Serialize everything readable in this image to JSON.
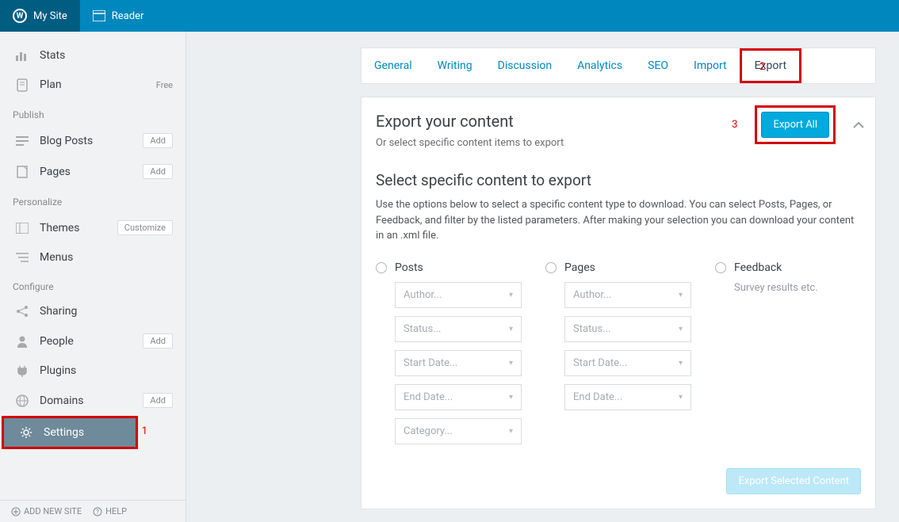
{
  "topbar": {
    "mysite": "My Site",
    "reader": "Reader"
  },
  "sidebar": {
    "stats": "Stats",
    "plan": "Plan",
    "plan_badge": "Free",
    "group_publish": "Publish",
    "blog_posts": "Blog Posts",
    "pages": "Pages",
    "add": "Add",
    "group_personalize": "Personalize",
    "themes": "Themes",
    "customize": "Customize",
    "menus": "Menus",
    "group_configure": "Configure",
    "sharing": "Sharing",
    "people": "People",
    "plugins": "Plugins",
    "domains": "Domains",
    "settings": "Settings",
    "footer_add": "ADD NEW SITE",
    "footer_help": "HELP"
  },
  "tabs": {
    "general": "General",
    "writing": "Writing",
    "discussion": "Discussion",
    "analytics": "Analytics",
    "seo": "SEO",
    "import": "Import",
    "export": "Export"
  },
  "export": {
    "title": "Export your content",
    "subtitle": "Or select specific content items to export",
    "button": "Export All",
    "section_title": "Select specific content to export",
    "section_desc": "Use the options below to select a specific content type to download. You can select Posts, Pages, or Feedback, and filter by the listed parameters. After making your selection you can download your content in an .xml file.",
    "posts": "Posts",
    "pages_label": "Pages",
    "feedback": "Feedback",
    "feedback_sub": "Survey results etc.",
    "author": "Author...",
    "status": "Status...",
    "start_date": "Start Date...",
    "end_date": "End Date...",
    "category": "Category...",
    "export_selected": "Export Selected Content"
  },
  "annotations": {
    "n1": "1",
    "n2": "2",
    "n3": "3"
  }
}
